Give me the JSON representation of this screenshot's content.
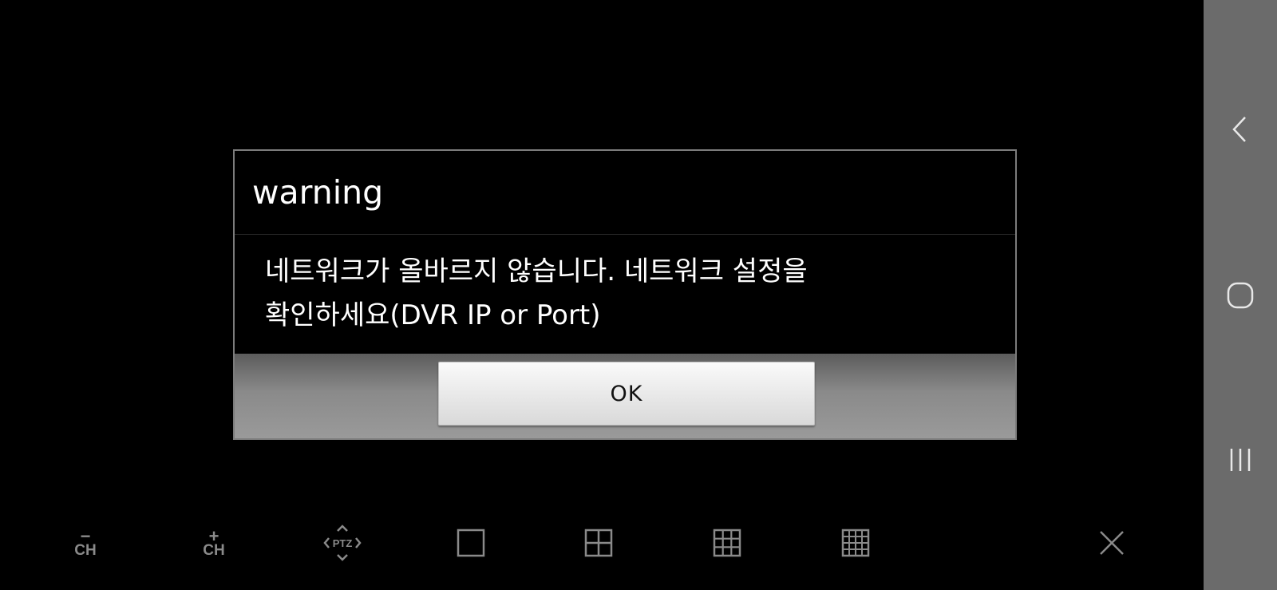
{
  "dialog": {
    "title": "warning",
    "message": "네트워크가 올바르지 않습니다. 네트워크 설정을\n확인하세요(DVR IP or Port)",
    "ok_label": "OK"
  },
  "toolbar": {
    "channel_down": {
      "sign": "−",
      "label": "CH",
      "icon": "channel-down-icon"
    },
    "channel_up": {
      "sign": "+",
      "label": "CH",
      "icon": "channel-up-icon"
    },
    "ptz": {
      "label": "PTZ",
      "icon": "ptz-icon"
    },
    "layouts": [
      {
        "icon": "single-view-icon",
        "grid": 1
      },
      {
        "icon": "quad-view-icon",
        "grid": 2
      },
      {
        "icon": "nine-view-icon",
        "grid": 3
      },
      {
        "icon": "sixteen-view-icon",
        "grid": 4
      }
    ],
    "close": {
      "icon": "close-icon"
    }
  },
  "navigation_bar": {
    "color": "#6b6b6b",
    "buttons": [
      "back-icon",
      "home-icon",
      "recent-apps-icon"
    ]
  },
  "colors": {
    "background": "#000000",
    "icon_gray": "#8a8a8a",
    "dialog_border": "#7c7c7c"
  }
}
